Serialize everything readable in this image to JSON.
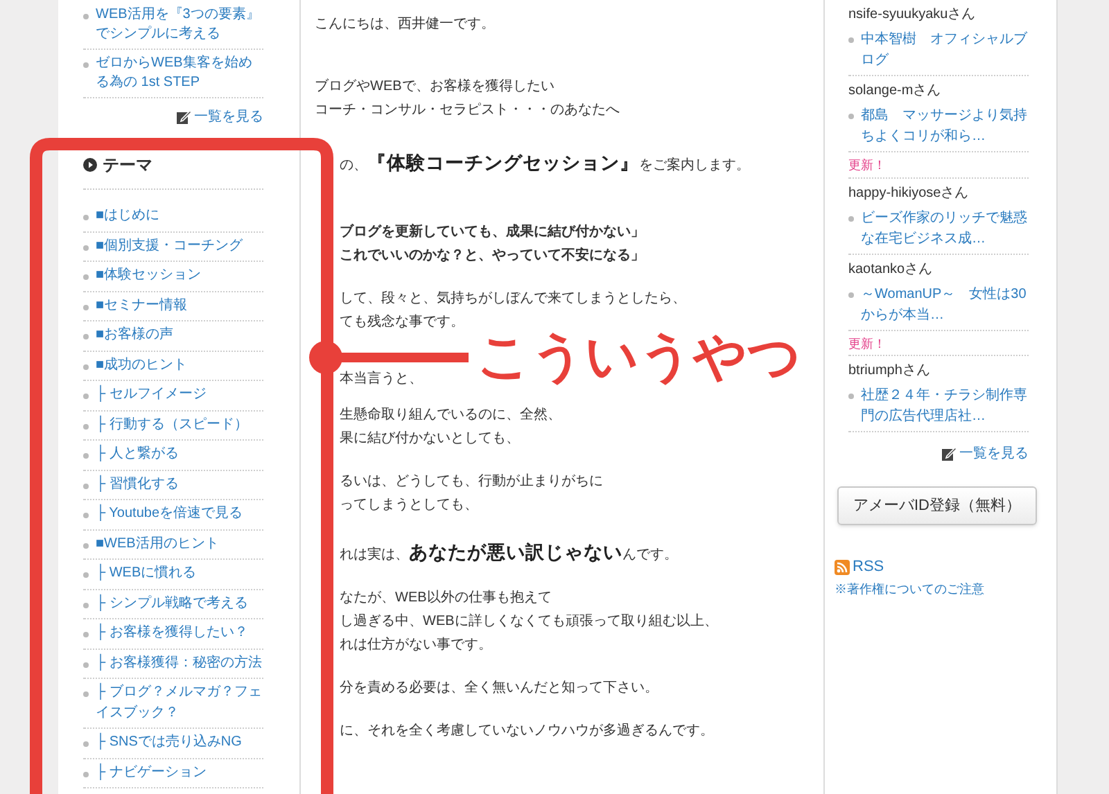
{
  "left_panel": {
    "posts": [
      "WEB活用を『3つの要素』でシンプルに考える",
      "ゼロからWEB集客を始める為の 1st STEP"
    ],
    "more_link": "一覧を見る"
  },
  "theme": {
    "title": "テーマ",
    "items": [
      "■はじめに",
      "■個別支援・コーチング",
      "■体験セッション",
      "■セミナー情報",
      "■お客様の声",
      "■成功のヒント",
      "├ セルフイメージ",
      "├ 行動する（スピード）",
      "├ 人と繋がる",
      "├ 習慣化する",
      "├ Youtubeを倍速で見る",
      "■WEB活用のヒント",
      "├ WEBに慣れる",
      "├ シンプル戦略で考える",
      "├ お客様を獲得したい？",
      "├ お客様獲得：秘密の方法",
      "├ ブログ？メルマガ？フェイスブック？",
      "├ SNSでは売り込みNG",
      "├ ナビゲーション"
    ]
  },
  "article": {
    "paragraphs": [
      {
        "kind": "plain",
        "lines": [
          {
            "text": "こんにちは、西井健一です。"
          }
        ]
      },
      {
        "kind": "plain",
        "lines": [
          {
            "text": "ブログやWEBで、お客様を獲得したい"
          },
          {
            "text": "コーチ・コンサル・セラピスト・・・のあなたへ"
          }
        ]
      },
      {
        "kind": "plain",
        "lines": [
          {
            "text": "の、**『体験コーチングセッション』**をご案内します。",
            "cut": true
          }
        ]
      },
      {
        "kind": "bold",
        "lines": [
          {
            "text": "ブログを更新していても、成果に結び付かない」",
            "cut": true
          },
          {
            "text": "これでいいのかな？と、やっていて不安になる」",
            "cut": true
          }
        ]
      },
      {
        "kind": "plain",
        "lines": [
          {
            "text": "して、段々と、気持ちがしぼんで来てしまうとしたら、",
            "cut": true
          },
          {
            "text": "ても残念な事です。",
            "cut": true
          }
        ]
      },
      {
        "kind": "plain",
        "lines": [
          {
            "text": "本当言うと、",
            "cut": true
          }
        ]
      },
      {
        "kind": "plain",
        "lines": [
          {
            "text": "生懸命取り組んでいるのに、全然、",
            "cut": true
          },
          {
            "text": "果に結び付かないとしても、",
            "cut": true
          }
        ]
      },
      {
        "kind": "plain",
        "lines": [
          {
            "text": "るいは、どうしても、行動が止まりがちに",
            "cut": true
          },
          {
            "text": "ってしまうとしても、",
            "cut": true
          }
        ]
      },
      {
        "kind": "plain",
        "lines": [
          {
            "text": "れは実は、**あなたが悪い訳じゃない**んです。",
            "cut": true
          }
        ]
      },
      {
        "kind": "plain",
        "lines": [
          {
            "text": "なたが、WEB以外の仕事も抱えて",
            "cut": true
          },
          {
            "text": "し過ぎる中、WEBに詳しくなくても頑張って取り組む以上、",
            "cut": true
          },
          {
            "text": "れは仕方がない事です。",
            "cut": true
          }
        ]
      },
      {
        "kind": "plain",
        "lines": [
          {
            "text": "分を責める必要は、全く無いんだと知って下さい。",
            "cut": true
          }
        ]
      },
      {
        "kind": "plain",
        "lines": [
          {
            "text": "に、それを全く考慮していないノウハウが多過ぎるんです。",
            "cut": true
          }
        ]
      }
    ]
  },
  "right_panel": {
    "entries": [
      {
        "user": "nsife-syuukyakuさん",
        "post": "中本智樹　オフィシャルブログ"
      },
      {
        "user": "solange-mさん",
        "post": "都島　マッサージより気持ちよくコリが和ら…"
      },
      {
        "badge": "更新！",
        "user": "happy-hikiyoseさん",
        "post": "ビーズ作家のリッチで魅惑な在宅ビジネス成…"
      },
      {
        "user": "kaotankoさん",
        "post": "～WomanUP～　女性は30からが本当…"
      },
      {
        "badge": "更新！",
        "user": "btriumphさん",
        "post": "社歴２４年・チラシ制作専門の広告代理店社…"
      }
    ],
    "more_link": "一覧を見る",
    "register_button": "アメーバID登録（無料）",
    "rss": "RSS",
    "copyright_link": "※著作権についてのご注意"
  },
  "annotation": {
    "label": "こういうやつ"
  }
}
